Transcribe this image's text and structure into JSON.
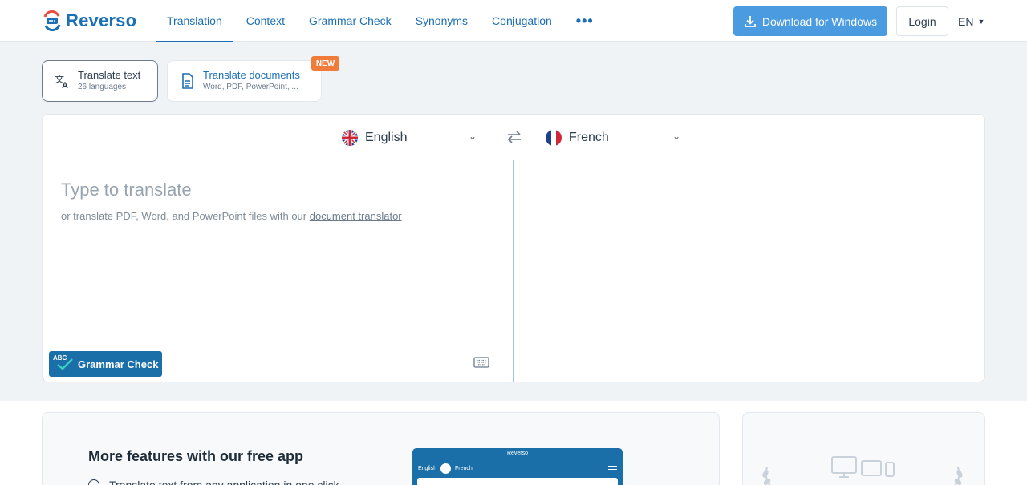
{
  "brand": {
    "name": "Reverso",
    "accent": "#1b6fb5"
  },
  "nav": {
    "items": [
      {
        "label": "Translation",
        "active": true
      },
      {
        "label": "Context"
      },
      {
        "label": "Grammar Check"
      },
      {
        "label": "Synonyms"
      },
      {
        "label": "Conjugation"
      }
    ],
    "more_label": "•••"
  },
  "header": {
    "download_label": "Download for Windows",
    "login_label": "Login",
    "ui_language": "EN"
  },
  "modes": {
    "text": {
      "title": "Translate text",
      "subtitle": "26 languages"
    },
    "documents": {
      "title": "Translate documents",
      "subtitle": "Word, PDF, PowerPoint, ...",
      "badge": "NEW"
    }
  },
  "translator": {
    "source_language": "English",
    "target_language": "French",
    "placeholder": "Type to translate",
    "hint_prefix": "or translate PDF, Word, and PowerPoint files with our ",
    "hint_link": "document translator",
    "grammar_check_label": "Grammar Check",
    "grammar_check_badge": "ABC"
  },
  "promo": {
    "title": "More features with our free app",
    "first_item": "Translate text from any application in one click",
    "app_brand": "Reverso",
    "app_source": "English",
    "app_target": "French"
  }
}
